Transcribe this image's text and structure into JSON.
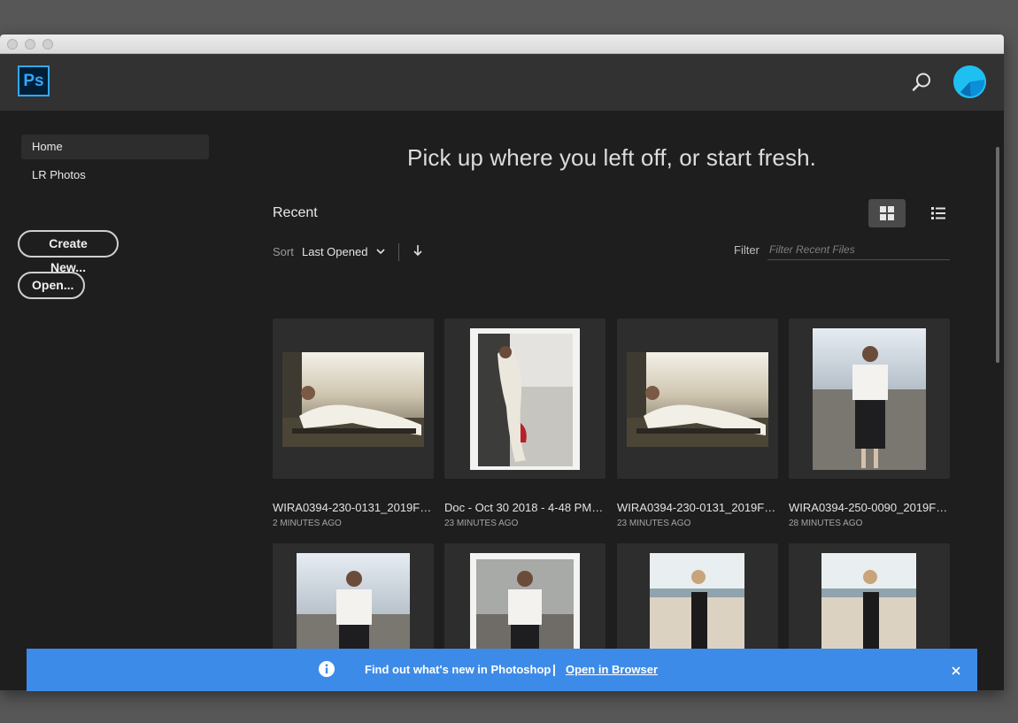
{
  "app": {
    "logo_text": "Ps",
    "accent": "#31a8ff"
  },
  "sidebar": {
    "items": [
      {
        "label": "Home",
        "active": true
      },
      {
        "label": "LR Photos",
        "active": false
      }
    ],
    "create_label": "Create New...",
    "open_label": "Open..."
  },
  "main": {
    "headline": "Pick up where you left off, or start fresh.",
    "recent_title": "Recent",
    "sort_label": "Sort",
    "sort_value": "Last Opened",
    "filter_label": "Filter",
    "filter_placeholder": "Filter Recent Files",
    "view_mode": "grid",
    "files": [
      {
        "name": "WIRA0394-230-0131_2019FC_...",
        "time": "2 MINUTES AGO",
        "thumb": "landscape-reclining-woman"
      },
      {
        "name": "Doc - Oct 30 2018 - 4-48 PM_...",
        "time": "23 MINUTES AGO",
        "thumb": "portrait-print-reclining-woman"
      },
      {
        "name": "WIRA0394-230-0131_2019FC_...",
        "time": "23 MINUTES AGO",
        "thumb": "landscape-reclining-woman"
      },
      {
        "name": "WIRA0394-250-0090_2019FC...",
        "time": "28 MINUTES AGO",
        "thumb": "portrait-standing-woman-city"
      },
      {
        "name": "",
        "time": "",
        "thumb": "portrait-standing-woman-city"
      },
      {
        "name": "",
        "time": "",
        "thumb": "portrait-print-standing-woman"
      },
      {
        "name": "",
        "time": "",
        "thumb": "portrait-woman-beach"
      },
      {
        "name": "",
        "time": "",
        "thumb": "portrait-woman-beach"
      }
    ]
  },
  "banner": {
    "text": "Find out what's new in Photoshop",
    "separator": "|",
    "link": "Open in Browser",
    "color": "#3d8be8"
  },
  "icons": {
    "search": "search-icon",
    "avatar": "user-avatar",
    "grid_view": "grid-view-icon",
    "list_view": "list-view-icon",
    "sort_dir": "arrow-down-icon",
    "info": "info-icon",
    "close": "close-icon"
  }
}
